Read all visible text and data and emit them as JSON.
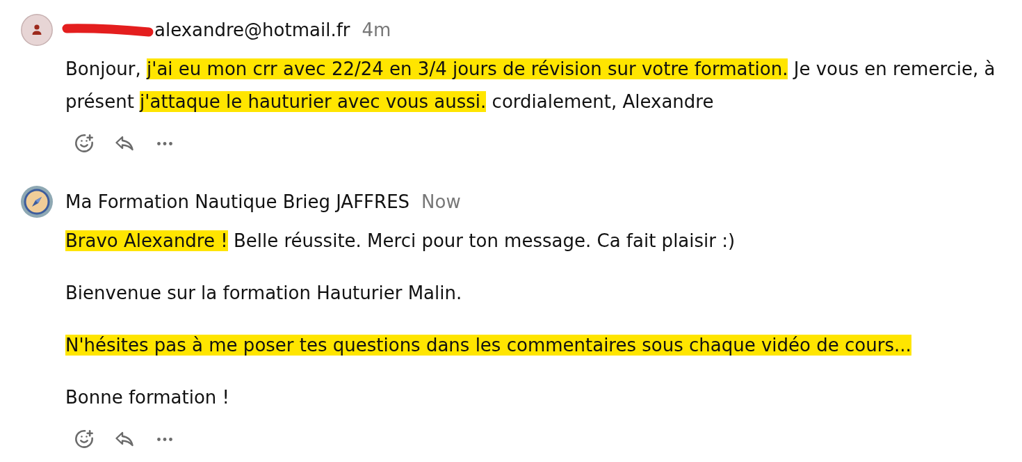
{
  "comments": [
    {
      "avatar": {
        "kind": "default"
      },
      "author": "alexandre@hotmail.fr",
      "author_redacted": true,
      "time": "4m",
      "body": [
        {
          "segments": [
            {
              "text": "Bonjour, ",
              "highlighted": false
            },
            {
              "text": "j'ai eu mon crr avec 22/24 en 3/4 jours de révision sur votre formation.",
              "highlighted": true
            },
            {
              "text": " Je vous en remercie, à présent ",
              "highlighted": false
            },
            {
              "text": "j'attaque le hauturier avec vous aussi.",
              "highlighted": true
            },
            {
              "text": " cordialement, Alexandre",
              "highlighted": false
            }
          ]
        }
      ]
    },
    {
      "avatar": {
        "kind": "logo"
      },
      "author": "Ma Formation Nautique Brieg JAFFRES",
      "author_redacted": false,
      "time": "Now",
      "body": [
        {
          "segments": [
            {
              "text": "Bravo Alexandre !",
              "highlighted": true
            },
            {
              "text": " Belle réussite. Merci pour ton message. Ca fait plaisir :)",
              "highlighted": false
            }
          ]
        },
        {
          "segments": [
            {
              "text": "Bienvenue sur la formation Hauturier Malin.",
              "highlighted": false
            }
          ]
        },
        {
          "segments": [
            {
              "text": "N'hésites pas à me poser tes questions dans les commentaires sous chaque vidéo de cours...",
              "highlighted": true
            }
          ]
        },
        {
          "segments": [
            {
              "text": "Bonne formation !",
              "highlighted": false
            }
          ]
        }
      ]
    }
  ]
}
